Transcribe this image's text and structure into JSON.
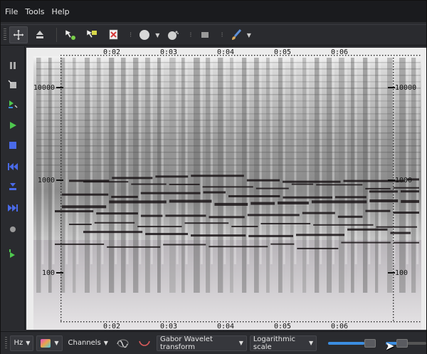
{
  "menu": {
    "file": "File",
    "tools": "Tools",
    "help": "Help"
  },
  "toolbar": {
    "icons": [
      "crosshair-icon",
      "spray-icon",
      "select-green-icon",
      "select-yellow-icon",
      "remove-red-icon",
      "circle-brush-icon",
      "dot-brush-icon",
      "square-icon",
      "paint-brush-icon"
    ]
  },
  "sidebar": {
    "icons": [
      "pause-icon",
      "crop-icon",
      "step-icon",
      "play-icon",
      "stop-icon",
      "rewind-icon",
      "record-icon",
      "forward-icon",
      "dot-icon",
      "next-icon"
    ]
  },
  "spectrogram": {
    "time_ticks_top": [
      "0:02",
      "0:03",
      "0:04",
      "0:05",
      "0:06"
    ],
    "time_ticks_bottom": [
      "0:02",
      "0:03",
      "0:04",
      "0:05",
      "0:06"
    ],
    "freq_ticks_left": [
      "10000",
      "1000",
      "100"
    ],
    "freq_ticks_right": [
      "10000",
      "1000",
      "100"
    ]
  },
  "bottom": {
    "unit_label": "Hz",
    "channels_label": "Channels",
    "transform_label": "Gabor Wavelet transform",
    "scale_label": "Logarithmic scale",
    "slider1_value": 0.78,
    "slider2_value": 0.35
  },
  "colors": {
    "accent": "#3b8de0",
    "background": "#2a2b2f",
    "canvas": "#eaeaea"
  }
}
